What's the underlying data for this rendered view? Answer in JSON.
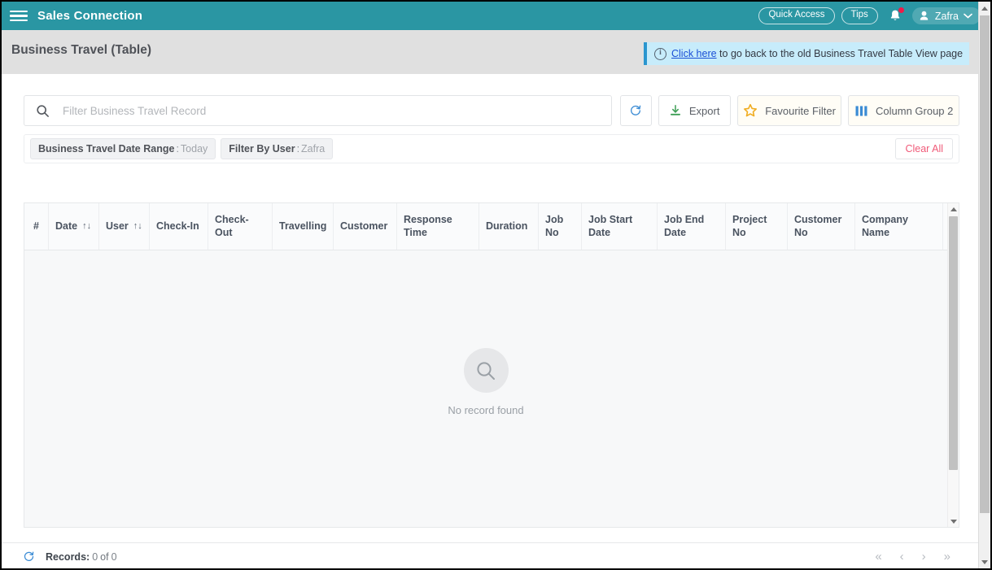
{
  "topbar": {
    "menu_icon": "hamburger-icon",
    "app_title": "Sales Connection",
    "quick_access_label": "Quick Access",
    "tips_label": "Tips",
    "bell_icon": "notification-bell-icon",
    "user_name": "Zafra",
    "teal": "#2a96a3"
  },
  "page": {
    "title": "Business Travel (Table)",
    "banner": {
      "icon": "info-circle-icon",
      "link_text": "Click here",
      "rest_text": " to go back to the old Business Travel Table View page",
      "bg": "#c7ecfb",
      "accent": "#2a96cf"
    }
  },
  "toolbar": {
    "search_placeholder": "Filter Business Travel Record",
    "search_value": "",
    "search_icon": "search-icon",
    "refresh_icon": "refresh-icon",
    "export_label": "Export",
    "export_icon": "download-icon",
    "favourite_label": "Favourite Filter",
    "favourite_icon": "star-icon",
    "column_group_label": "Column Group 2",
    "column_group_icon": "columns-icon"
  },
  "filters": {
    "chips": [
      {
        "label": "Business Travel Date Range",
        "sep": ":",
        "value": "Today"
      },
      {
        "label": "Filter By User",
        "sep": ":",
        "value": "Zafra"
      }
    ],
    "clear_all_label": "Clear All"
  },
  "table": {
    "columns": [
      {
        "label": "#",
        "width": 30,
        "sortable": false,
        "center": true
      },
      {
        "label": "Date",
        "width": 62,
        "sortable": true,
        "center": false
      },
      {
        "label": "User",
        "width": 62,
        "sortable": true,
        "center": false
      },
      {
        "label": "Check-In",
        "width": 72,
        "sortable": false,
        "center": false
      },
      {
        "label": "Check-Out",
        "width": 79,
        "sortable": false,
        "center": false
      },
      {
        "label": "Travelling",
        "width": 75,
        "sortable": false,
        "center": false
      },
      {
        "label": "Customer",
        "width": 78,
        "sortable": false,
        "center": false
      },
      {
        "label": "Response Time",
        "width": 101,
        "sortable": false,
        "center": false
      },
      {
        "label": "Duration",
        "width": 73,
        "sortable": false,
        "center": false
      },
      {
        "label": "Job No",
        "width": 53,
        "sortable": false,
        "center": false
      },
      {
        "label": "Job Start Date",
        "width": 93,
        "sortable": false,
        "center": false
      },
      {
        "label": "Job End Date",
        "width": 84,
        "sortable": false,
        "center": false
      },
      {
        "label": "Project No",
        "width": 76,
        "sortable": false,
        "center": false
      },
      {
        "label": "Customer No",
        "width": 83,
        "sortable": false,
        "center": false
      },
      {
        "label": "Company Name",
        "width": 108,
        "sortable": false,
        "center": false
      }
    ],
    "sort_glyph": "↑↓",
    "rows": [],
    "empty_icon": "search-icon",
    "empty_text": "No record found"
  },
  "footer": {
    "refresh_icon": "refresh-icon",
    "records_label": "Records:",
    "records_count": "0",
    "of_label": "of",
    "records_total": "0",
    "pager": {
      "first": "«",
      "prev": "‹",
      "next": "›",
      "last": "»"
    }
  }
}
